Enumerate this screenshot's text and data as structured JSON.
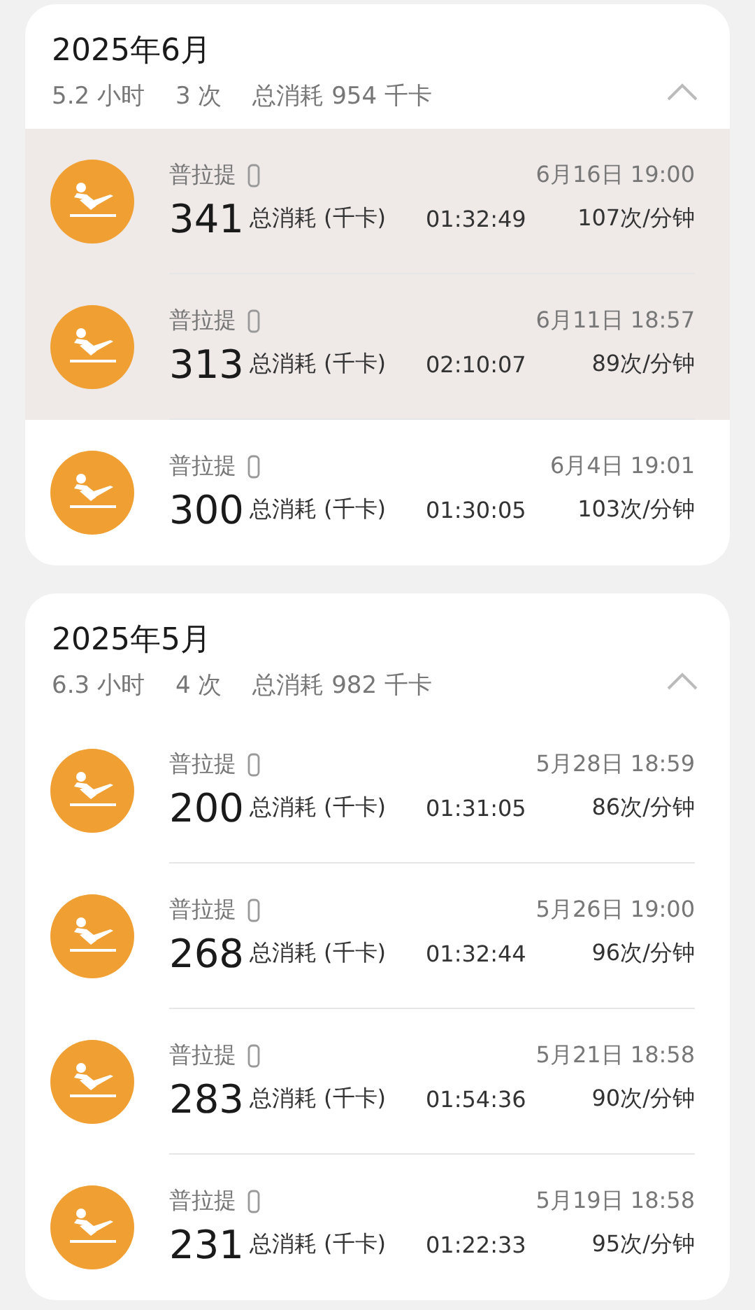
{
  "months": [
    {
      "title": "2025年6月",
      "expanded": true,
      "stats": [
        "5.2 小时",
        "3 次",
        "总消耗 954 千卡"
      ],
      "workouts": [
        {
          "name": "普拉提",
          "time": "6月16日 19:00",
          "calories": "341",
          "calories_label": "总消耗 (千卡)",
          "duration": "01:32:49",
          "rate": "107次/分钟",
          "highlighted": true
        },
        {
          "name": "普拉提",
          "time": "6月11日 18:57",
          "calories": "313",
          "calories_label": "总消耗 (千卡)",
          "duration": "02:10:07",
          "rate": "89次/分钟",
          "highlighted": true
        },
        {
          "name": "普拉提",
          "time": "6月4日 19:01",
          "calories": "300",
          "calories_label": "总消耗 (千卡)",
          "duration": "01:30:05",
          "rate": "103次/分钟",
          "highlighted": false
        }
      ]
    },
    {
      "title": "2025年5月",
      "expanded": true,
      "stats": [
        "6.3 小时",
        "4 次",
        "总消耗 982 千卡"
      ],
      "workouts": [
        {
          "name": "普拉提",
          "time": "5月28日 18:59",
          "calories": "200",
          "calories_label": "总消耗 (千卡)",
          "duration": "01:31:05",
          "rate": "86次/分钟",
          "highlighted": false
        },
        {
          "name": "普拉提",
          "time": "5月26日 19:00",
          "calories": "268",
          "calories_label": "总消耗 (千卡)",
          "duration": "01:32:44",
          "rate": "96次/分钟",
          "highlighted": false
        },
        {
          "name": "普拉提",
          "time": "5月21日 18:58",
          "calories": "283",
          "calories_label": "总消耗 (千卡)",
          "duration": "01:54:36",
          "rate": "90次/分钟",
          "highlighted": false
        },
        {
          "name": "普拉提",
          "time": "5月19日 18:58",
          "calories": "231",
          "calories_label": "总消耗 (千卡)",
          "duration": "01:22:33",
          "rate": "95次/分钟",
          "highlighted": false
        }
      ]
    }
  ]
}
